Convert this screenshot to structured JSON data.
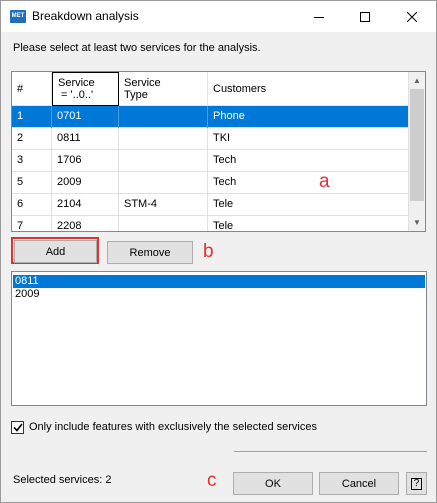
{
  "window": {
    "app_icon_text": "MET",
    "title": "Breakdown analysis"
  },
  "instruction": "Please select at least two services for the analysis.",
  "grid": {
    "columns": [
      "#",
      "Service\n = '..0..'",
      "Service\nType",
      "Customers"
    ],
    "rows": [
      {
        "num": "1",
        "service": "0701",
        "type": "",
        "customer": "Phone"
      },
      {
        "num": "2",
        "service": "0811",
        "type": "",
        "customer": "TKI"
      },
      {
        "num": "3",
        "service": "1706",
        "type": "",
        "customer": "Tech"
      },
      {
        "num": "5",
        "service": "2009",
        "type": "",
        "customer": "Tech"
      },
      {
        "num": "6",
        "service": "2104",
        "type": "STM-4",
        "customer": "Tele"
      },
      {
        "num": "7",
        "service": "2208",
        "type": "",
        "customer": "Tele"
      }
    ],
    "selected_row": 0
  },
  "buttons": {
    "add": "Add",
    "remove": "Remove",
    "ok": "OK",
    "cancel": "Cancel",
    "help": "?"
  },
  "annotations": {
    "a": "a",
    "b": "b",
    "c": "c"
  },
  "selected_list": {
    "items": [
      "0811",
      "2009"
    ],
    "selected_index": 0
  },
  "exclusive_checkbox": {
    "label": "Only include features with exclusively the selected services",
    "checked": true
  },
  "status": "Selected services: 2",
  "colors": {
    "selection": "#0078d7",
    "annotation": "#e53030"
  }
}
